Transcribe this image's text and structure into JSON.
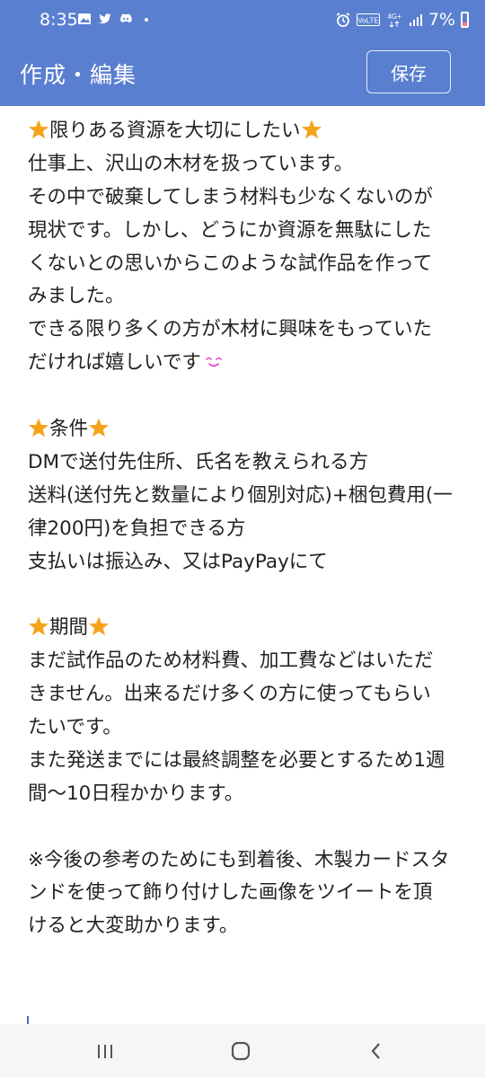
{
  "status_bar": {
    "time": "8:35",
    "battery_percent": "7%",
    "network_label": "4G+",
    "volte_label": "VoLTE"
  },
  "app_bar": {
    "title": "作成・編集",
    "save_label": "保存"
  },
  "editor": {
    "lines": [
      "限りある資源を大切にしたい",
      "仕事上、沢山の木材を扱っています。",
      "その中で破棄してしまう材料も少なくないのが",
      "現状です。しかし、どうにか資源を無駄にした",
      "くないとの思いからこのような試作品を作って",
      "みました。",
      "できる限り多くの方が木材に興味をもっていた",
      "だければ嬉しいです",
      "",
      "条件",
      "DMで送付先住所、氏名を教えられる方",
      "送料(送付先と数量により個別対応)+梱包費用(一",
      "律200円)を負担できる方",
      "支払いは振込み、又はPayPayにて",
      "",
      "期間",
      "まだ試作品のため材料費、加工費などはいただ",
      "きません。出来るだけ多くの方に使ってもらい",
      "たいです。",
      "また発送までには最終調整を必要とするため1週",
      "間〜10日程かかります。",
      "",
      "※今後の参考のためにも到着後、木製カードスタ",
      "ンドを使って飾り付けした画像をツイートを頂",
      "けると大変助かります。"
    ]
  },
  "icons": {
    "star_color": "#f5a31a",
    "smile_color": "#e040c8",
    "accent": "#5a7fd0"
  }
}
